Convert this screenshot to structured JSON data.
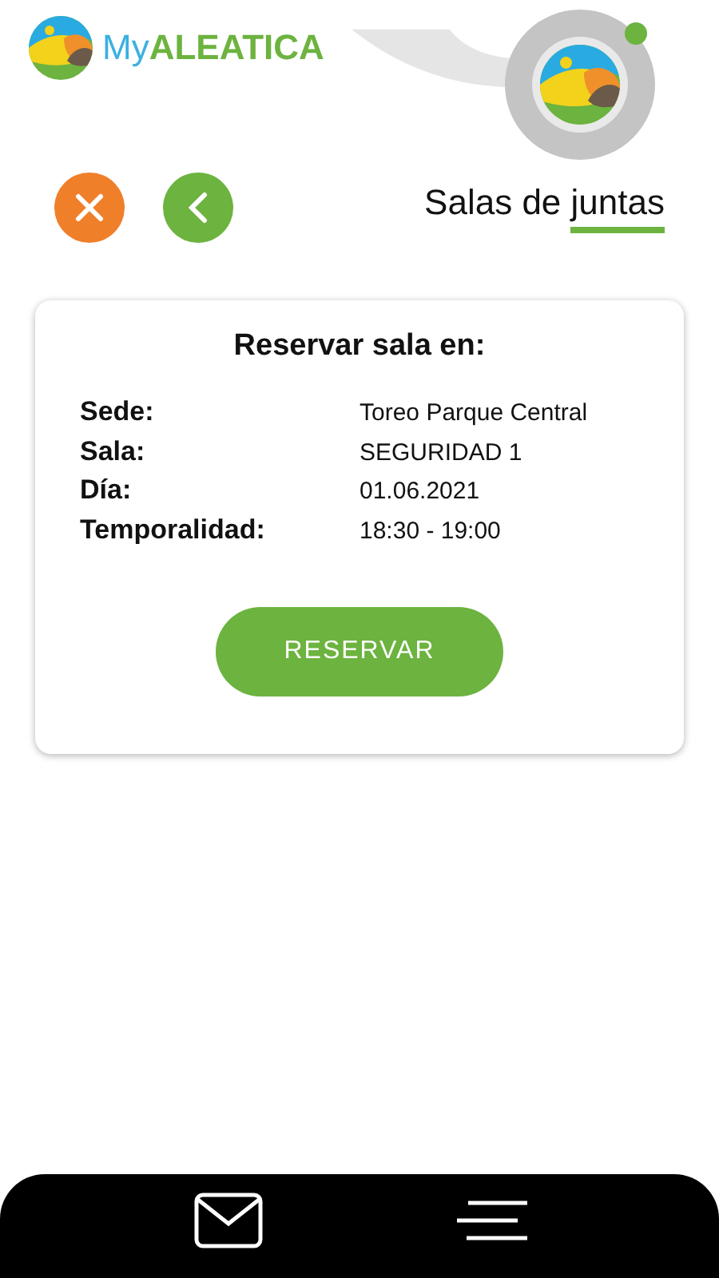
{
  "header": {
    "logo_prefix": "My",
    "logo_name": "ALEATICA",
    "avatar_online": true
  },
  "page_title": {
    "text": "Salas de ",
    "underlined": "juntas"
  },
  "card": {
    "title": "Reservar sala en:",
    "fields": [
      {
        "label": "Sede:",
        "value": "Toreo Parque Central"
      },
      {
        "label": "Sala:",
        "value": "SEGURIDAD 1"
      },
      {
        "label": "Día:",
        "value": "01.06.2021"
      },
      {
        "label": "Temporalidad:",
        "value": "18:30 - 19:00"
      }
    ],
    "button": "RESERVAR"
  }
}
